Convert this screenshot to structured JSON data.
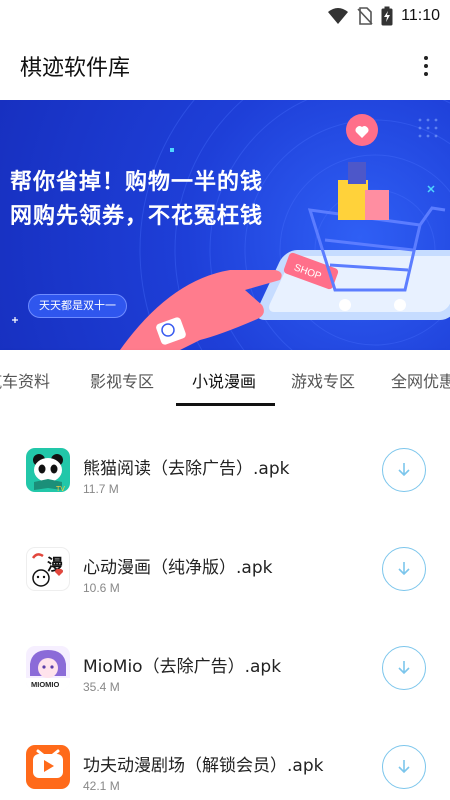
{
  "status_bar": {
    "time": "11:10",
    "icons": [
      "wifi-icon",
      "no-sim-icon",
      "battery-charging-icon"
    ]
  },
  "app_bar": {
    "title": "棋迹软件库",
    "menu_icon": "more-vertical-icon"
  },
  "banner": {
    "line1": "帮你省掉！购物一半的钱",
    "line2": "网购先领券，不花冤枉钱",
    "pill": "天天都是双十一",
    "phone_button": "SHOP"
  },
  "tabs": {
    "items": [
      {
        "label": "汽车资料"
      },
      {
        "label": "影视专区"
      },
      {
        "label": "小说漫画"
      },
      {
        "label": "游戏专区"
      },
      {
        "label": "全网优惠"
      }
    ],
    "active": "小说漫画"
  },
  "files": [
    {
      "name": "熊猫阅读（去除广告）.apk",
      "size": "11.7 M",
      "icon": "panda-reader-icon",
      "badge": "TV"
    },
    {
      "name": "心动漫画（纯净版）.apk",
      "size": "10.6 M",
      "icon": "comic-heart-icon",
      "badge": "漫"
    },
    {
      "name": "MioMio（去除广告）.apk",
      "size": "35.4 M",
      "icon": "miomio-icon",
      "badge": "MIOMIO"
    },
    {
      "name": "功夫动漫剧场（解锁会员）.apk",
      "size": "42.1 M",
      "icon": "kungfu-anime-icon",
      "badge": ""
    }
  ],
  "colors": {
    "banner_blue": "#1e3fd8",
    "download_accent": "#7cc6ec",
    "tab_active": "#111111",
    "tab_inactive": "#555555"
  }
}
